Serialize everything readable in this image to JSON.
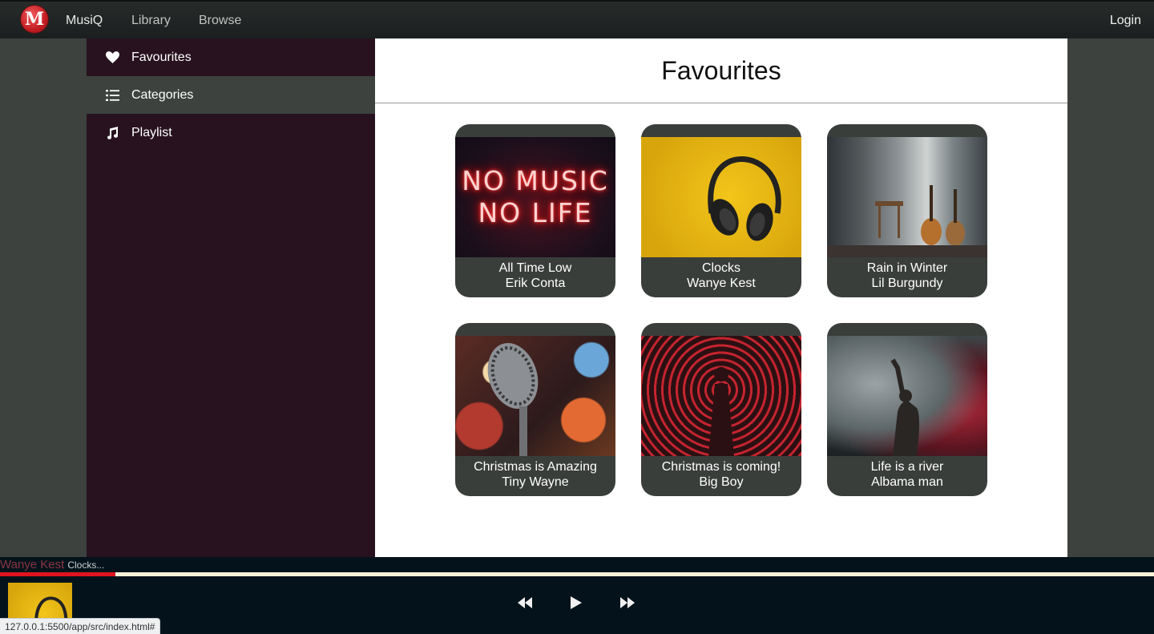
{
  "navbar": {
    "logo_letter": "M",
    "brand": "MusiQ",
    "links": [
      "Library",
      "Browse"
    ],
    "login": "Login"
  },
  "sidebar": {
    "items": [
      {
        "label": "Favourites",
        "icon": "heart-icon"
      },
      {
        "label": "Categories",
        "icon": "list-icon",
        "active": true
      },
      {
        "label": "Playlist",
        "icon": "music-note-icon"
      }
    ]
  },
  "main": {
    "title": "Favourites",
    "cards": [
      {
        "title": "All Time Low",
        "artist": "Erik Conta",
        "art": "neon-sign",
        "art_text": [
          "NO MUSIC",
          "NO LIFE"
        ]
      },
      {
        "title": "Clocks",
        "artist": "Wanye Kest",
        "art": "headphones-on-yellow"
      },
      {
        "title": "Rain in Winter",
        "artist": "Lil Burgundy",
        "art": "room-with-guitars"
      },
      {
        "title": "Christmas is Amazing",
        "artist": "Tiny Wayne",
        "art": "microphone-bokeh"
      },
      {
        "title": "Christmas is coming!",
        "artist": "Big Boy",
        "art": "red-illustration"
      },
      {
        "title": "Life is a river",
        "artist": "Albama man",
        "art": "performer-in-smoke"
      }
    ]
  },
  "player": {
    "artist": "Wanye Kest",
    "track": "Clocks...",
    "progress_fraction": 0.1,
    "colors": {
      "progress": "#e0141e",
      "track_bg": "#f6f4d8",
      "bar": "#04131b"
    }
  },
  "status_url": "127.0.0.1:5500/app/src/index.html#"
}
